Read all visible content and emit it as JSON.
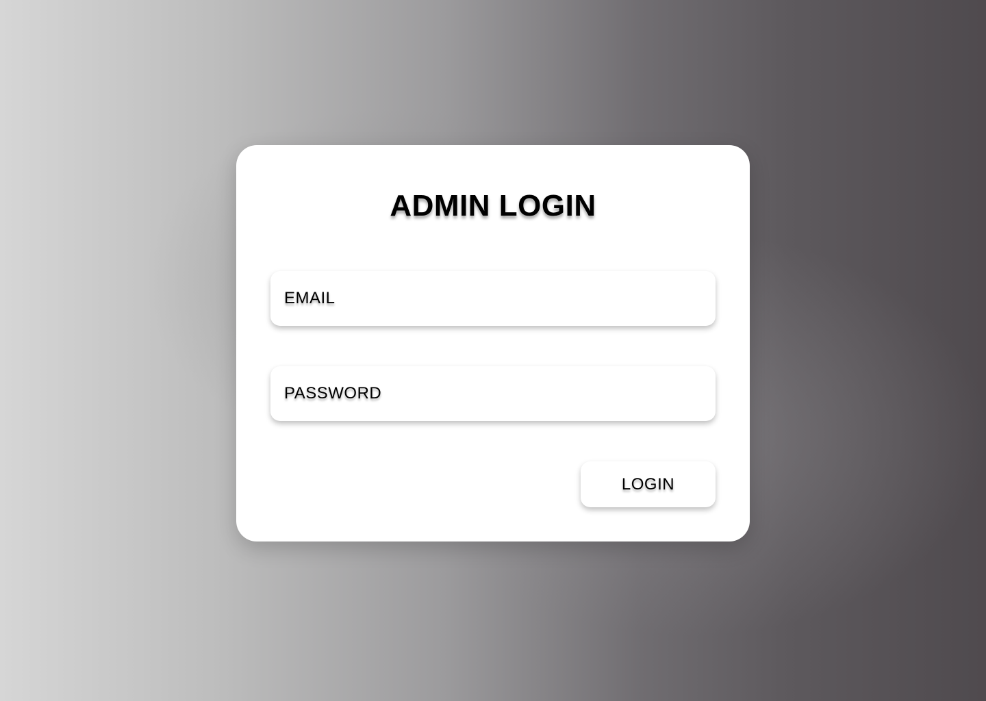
{
  "login_card": {
    "title": "ADMIN LOGIN",
    "email_placeholder": "EMAIL",
    "password_placeholder": "PASSWORD",
    "login_button_label": "LOGIN"
  }
}
